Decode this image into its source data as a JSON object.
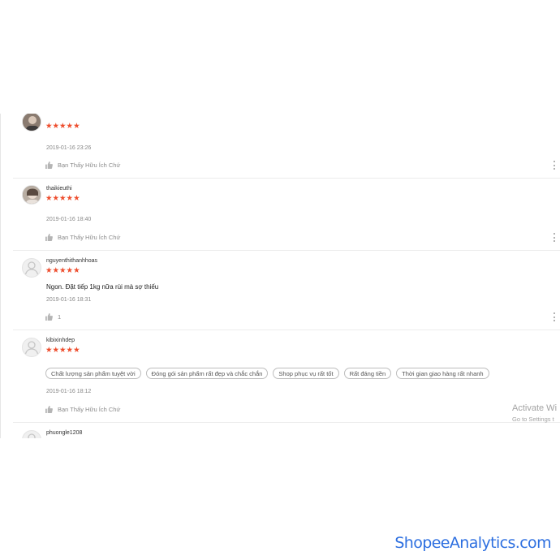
{
  "reviews": [
    {
      "username": "",
      "stars": "★★★★★",
      "date": "2019-01-16 23:26",
      "like_label": "Bạn Thấy Hữu Ích Chứ"
    },
    {
      "username": "thaikieuthi",
      "stars": "★★★★★",
      "date": "2019-01-16 18:40",
      "like_label": "Bạn Thấy Hữu Ích Chứ"
    },
    {
      "username": "nguyenthithanhhoas",
      "stars": "★★★★★",
      "comment": "Ngon. Đặt tiếp 1kg nữa rùi mà sợ thiếu",
      "date": "2019-01-16 18:31",
      "like_label": "1"
    },
    {
      "username": "kibixinhdep",
      "stars": "★★★★★",
      "tags": [
        "Chất lượng sản phẩm tuyệt vời",
        "Đóng gói sản phẩm rất đẹp và chắc chắn",
        "Shop phục vụ rất tốt",
        "Rất đáng tiền",
        "Thời gian giao hàng rất nhanh"
      ],
      "date": "2019-01-16 18:12",
      "like_label": "Bạn Thấy Hữu Ích Chứ"
    },
    {
      "username": "phuongle1208"
    }
  ],
  "windows_overlay": {
    "title": "Activate Wi",
    "subtitle": "Go to Settings t"
  },
  "watermark": "ShopeeAnalytics.com",
  "colors": {
    "star": "#ee4d2d",
    "watermark": "#2d6fe0"
  }
}
